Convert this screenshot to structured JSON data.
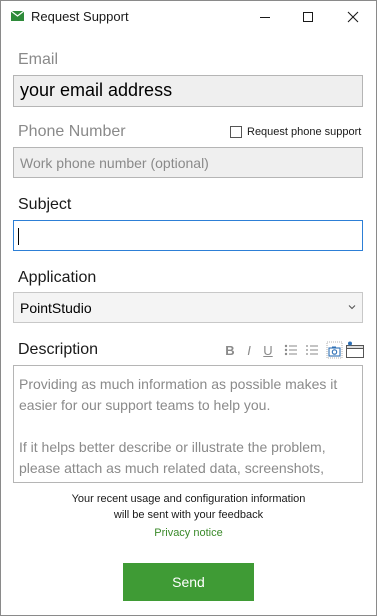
{
  "window": {
    "title": "Request Support"
  },
  "email": {
    "label": "Email",
    "value": "your email address"
  },
  "phone": {
    "label": "Phone Number",
    "placeholder": "Work phone number (optional)",
    "checkbox_label": "Request phone support",
    "checked": false
  },
  "subject": {
    "label": "Subject",
    "value": ""
  },
  "application": {
    "label": "Application",
    "selected": "PointStudio"
  },
  "description": {
    "label": "Description",
    "toolbar": {
      "bold": "B",
      "italic": "I",
      "underline": "U"
    },
    "placeholder_p1": "Providing as much information as possible makes it easier for our support teams to help you.",
    "placeholder_p2": "If it helps better describe or illustrate the problem, please attach as much related data, screenshots, videos, scripts, and files as needed to this"
  },
  "notice": {
    "line1": "Your recent usage and configuration information",
    "line2": "will be sent with your feedback"
  },
  "privacy_link": "Privacy notice",
  "send_label": "Send",
  "colors": {
    "accent": "#3f9b35",
    "focus": "#2d7fd6",
    "link": "#3a8a2a"
  }
}
